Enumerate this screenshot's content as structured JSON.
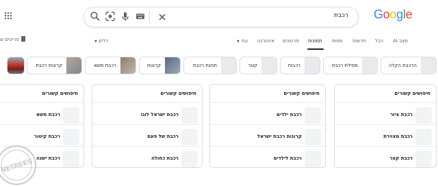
{
  "logo": {
    "letters": [
      "G",
      "o",
      "o",
      "g",
      "l",
      "e"
    ],
    "colors": [
      "#4285f4",
      "#ea4335",
      "#fbbc05",
      "#4285f4",
      "#34a853",
      "#ea4335"
    ]
  },
  "search": {
    "query": "רכבת",
    "icons": [
      "close-icon",
      "keyboard-icon",
      "mic-icon",
      "lens-icon",
      "search-icon"
    ]
  },
  "tabs": [
    {
      "label": "מצב AI",
      "active": false
    },
    {
      "label": "הכל",
      "active": false
    },
    {
      "label": "חדשות",
      "active": false
    },
    {
      "label": "מפות",
      "active": false
    },
    {
      "label": "תמונות",
      "active": true
    },
    {
      "label": "סרטונים",
      "active": false
    },
    {
      "label": "אינטרנט",
      "active": false
    },
    {
      "label": "עוד",
      "active": false
    }
  ],
  "tools_label": "כלים",
  "left_partial": "פריטים ש",
  "chips": [
    {
      "label": "הרכבת הקלה"
    },
    {
      "label": "מסילת רכבת"
    },
    {
      "label": "רכבות"
    },
    {
      "label": "קטר"
    },
    {
      "label": "תחנת רכבת"
    },
    {
      "label": "קרונות"
    },
    {
      "label": "רכבת משא"
    },
    {
      "label": "קרונות רכבת"
    },
    {
      "label": ""
    }
  ],
  "cards": [
    {
      "title": "חיפושים קשורים",
      "items": [
        "רכבת ציור",
        "רכבת מצוירת",
        "רכבת קטר"
      ]
    },
    {
      "title": "חיפושים קשורים",
      "items": [
        "רכבת ילדים",
        "קרונות רכבת ישראל",
        "רכבת לילדים"
      ]
    },
    {
      "title": "חיפושים קשורים",
      "items": [
        "רכבת ישראל לוגו",
        "רכבת של פעם",
        "רכבת כחולה"
      ]
    },
    {
      "title": "חיפושים קשורים",
      "items": [
        "רכבת משא",
        "רכבת קיטור",
        "רכבת ישנה"
      ]
    }
  ],
  "watermark": {
    "text": "NETREES"
  }
}
